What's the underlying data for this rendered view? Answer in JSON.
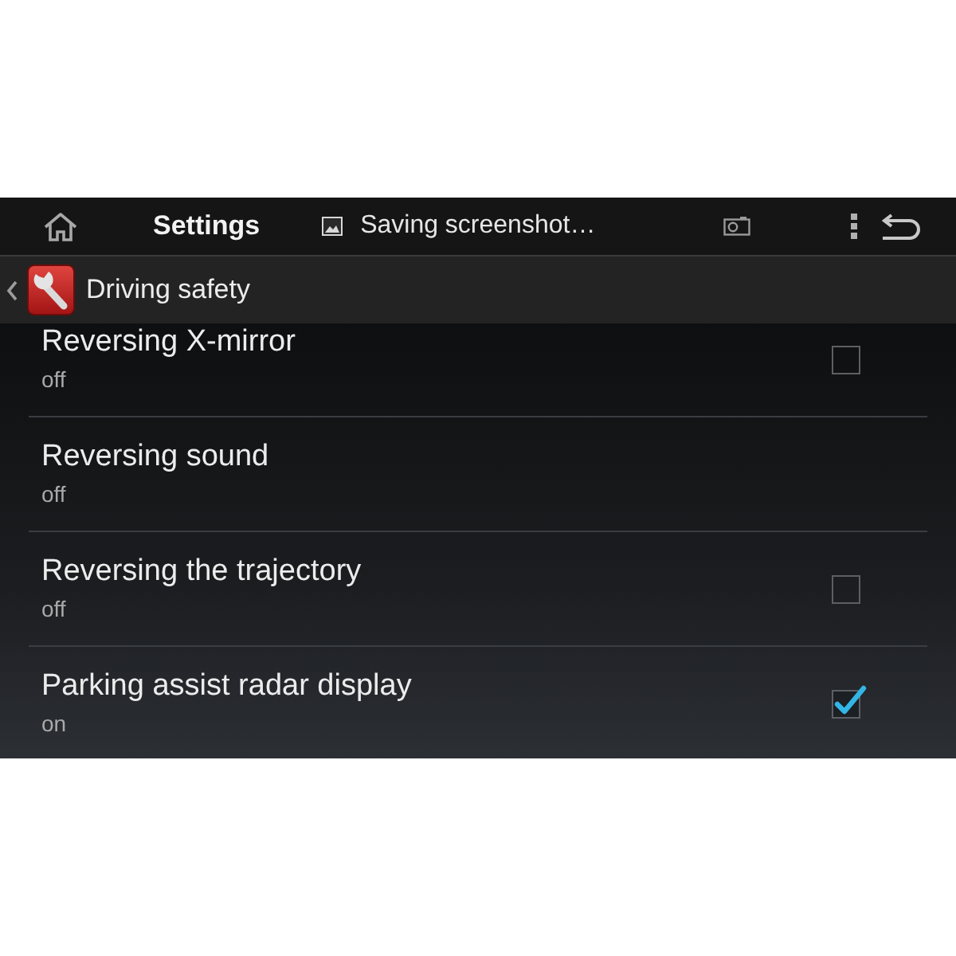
{
  "status_bar": {
    "title": "Settings",
    "notification": "Saving screenshot…"
  },
  "header": {
    "title": "Driving safety"
  },
  "settings": [
    {
      "kind": "checkbox",
      "title": "Reversing X-mirror",
      "summary": "off",
      "checked": false
    },
    {
      "kind": "text",
      "title": "Reversing sound",
      "summary": "off"
    },
    {
      "kind": "checkbox",
      "title": "Reversing the trajectory",
      "summary": "off",
      "checked": false
    },
    {
      "kind": "checkbox",
      "title": "Parking assist radar display",
      "summary": "on",
      "checked": true
    }
  ]
}
